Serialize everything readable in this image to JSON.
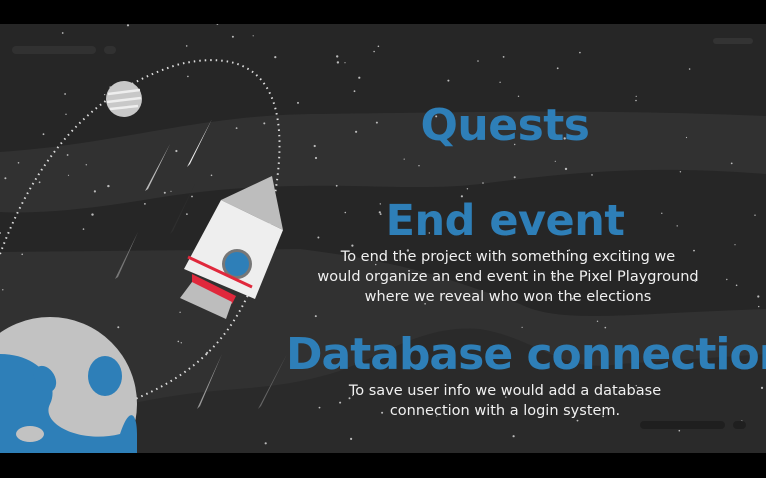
{
  "slide": {
    "title": "Quests",
    "sections": [
      {
        "heading": "End event",
        "body_lines": [
          "To end the project with something exciting we",
          "would organize an end event in the Pixel Playground",
          "where we reveal who won the elections"
        ]
      },
      {
        "heading": "Database connection",
        "body_lines": [
          "To save user info we would add a database",
          "connection with a login system."
        ]
      }
    ]
  },
  "colors": {
    "accent": "#2e7fb8",
    "background": "#262626",
    "text": "#f0f0f0",
    "rocket_stripe": "#e0283c"
  }
}
